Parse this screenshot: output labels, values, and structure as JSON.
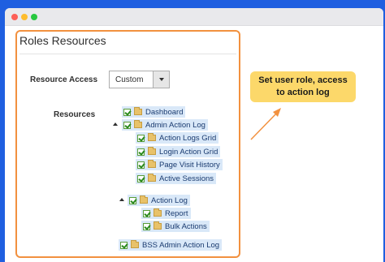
{
  "panel": {
    "title": "Roles Resources",
    "resource_access_label": "Resource Access",
    "resource_access_value": "Custom",
    "resources_label": "Resources"
  },
  "tree": {
    "dashboard": "Dashboard",
    "admin_action_log": "Admin Action Log",
    "action_logs_grid": "Action Logs Grid",
    "login_action_grid": "Login Action Grid",
    "page_visit_history": "Page Visit History",
    "active_sessions": "Active Sessions",
    "action_log": "Action Log",
    "report": "Report",
    "bulk_actions": "Bulk Actions",
    "bss_admin_action_log": "BSS Admin Action Log"
  },
  "callout": {
    "line1": "Set user role, access",
    "line2": "to action log"
  },
  "colors": {
    "background": "#1f5fe0",
    "accent_border": "#f2913f",
    "callout": "#fcd86a",
    "node_highlight": "#d9e8f8"
  },
  "icons": [
    "checkbox-checked-icon",
    "folder-icon",
    "collapse-toggle-icon",
    "arrow-icon",
    "dropdown-caret-icon"
  ]
}
